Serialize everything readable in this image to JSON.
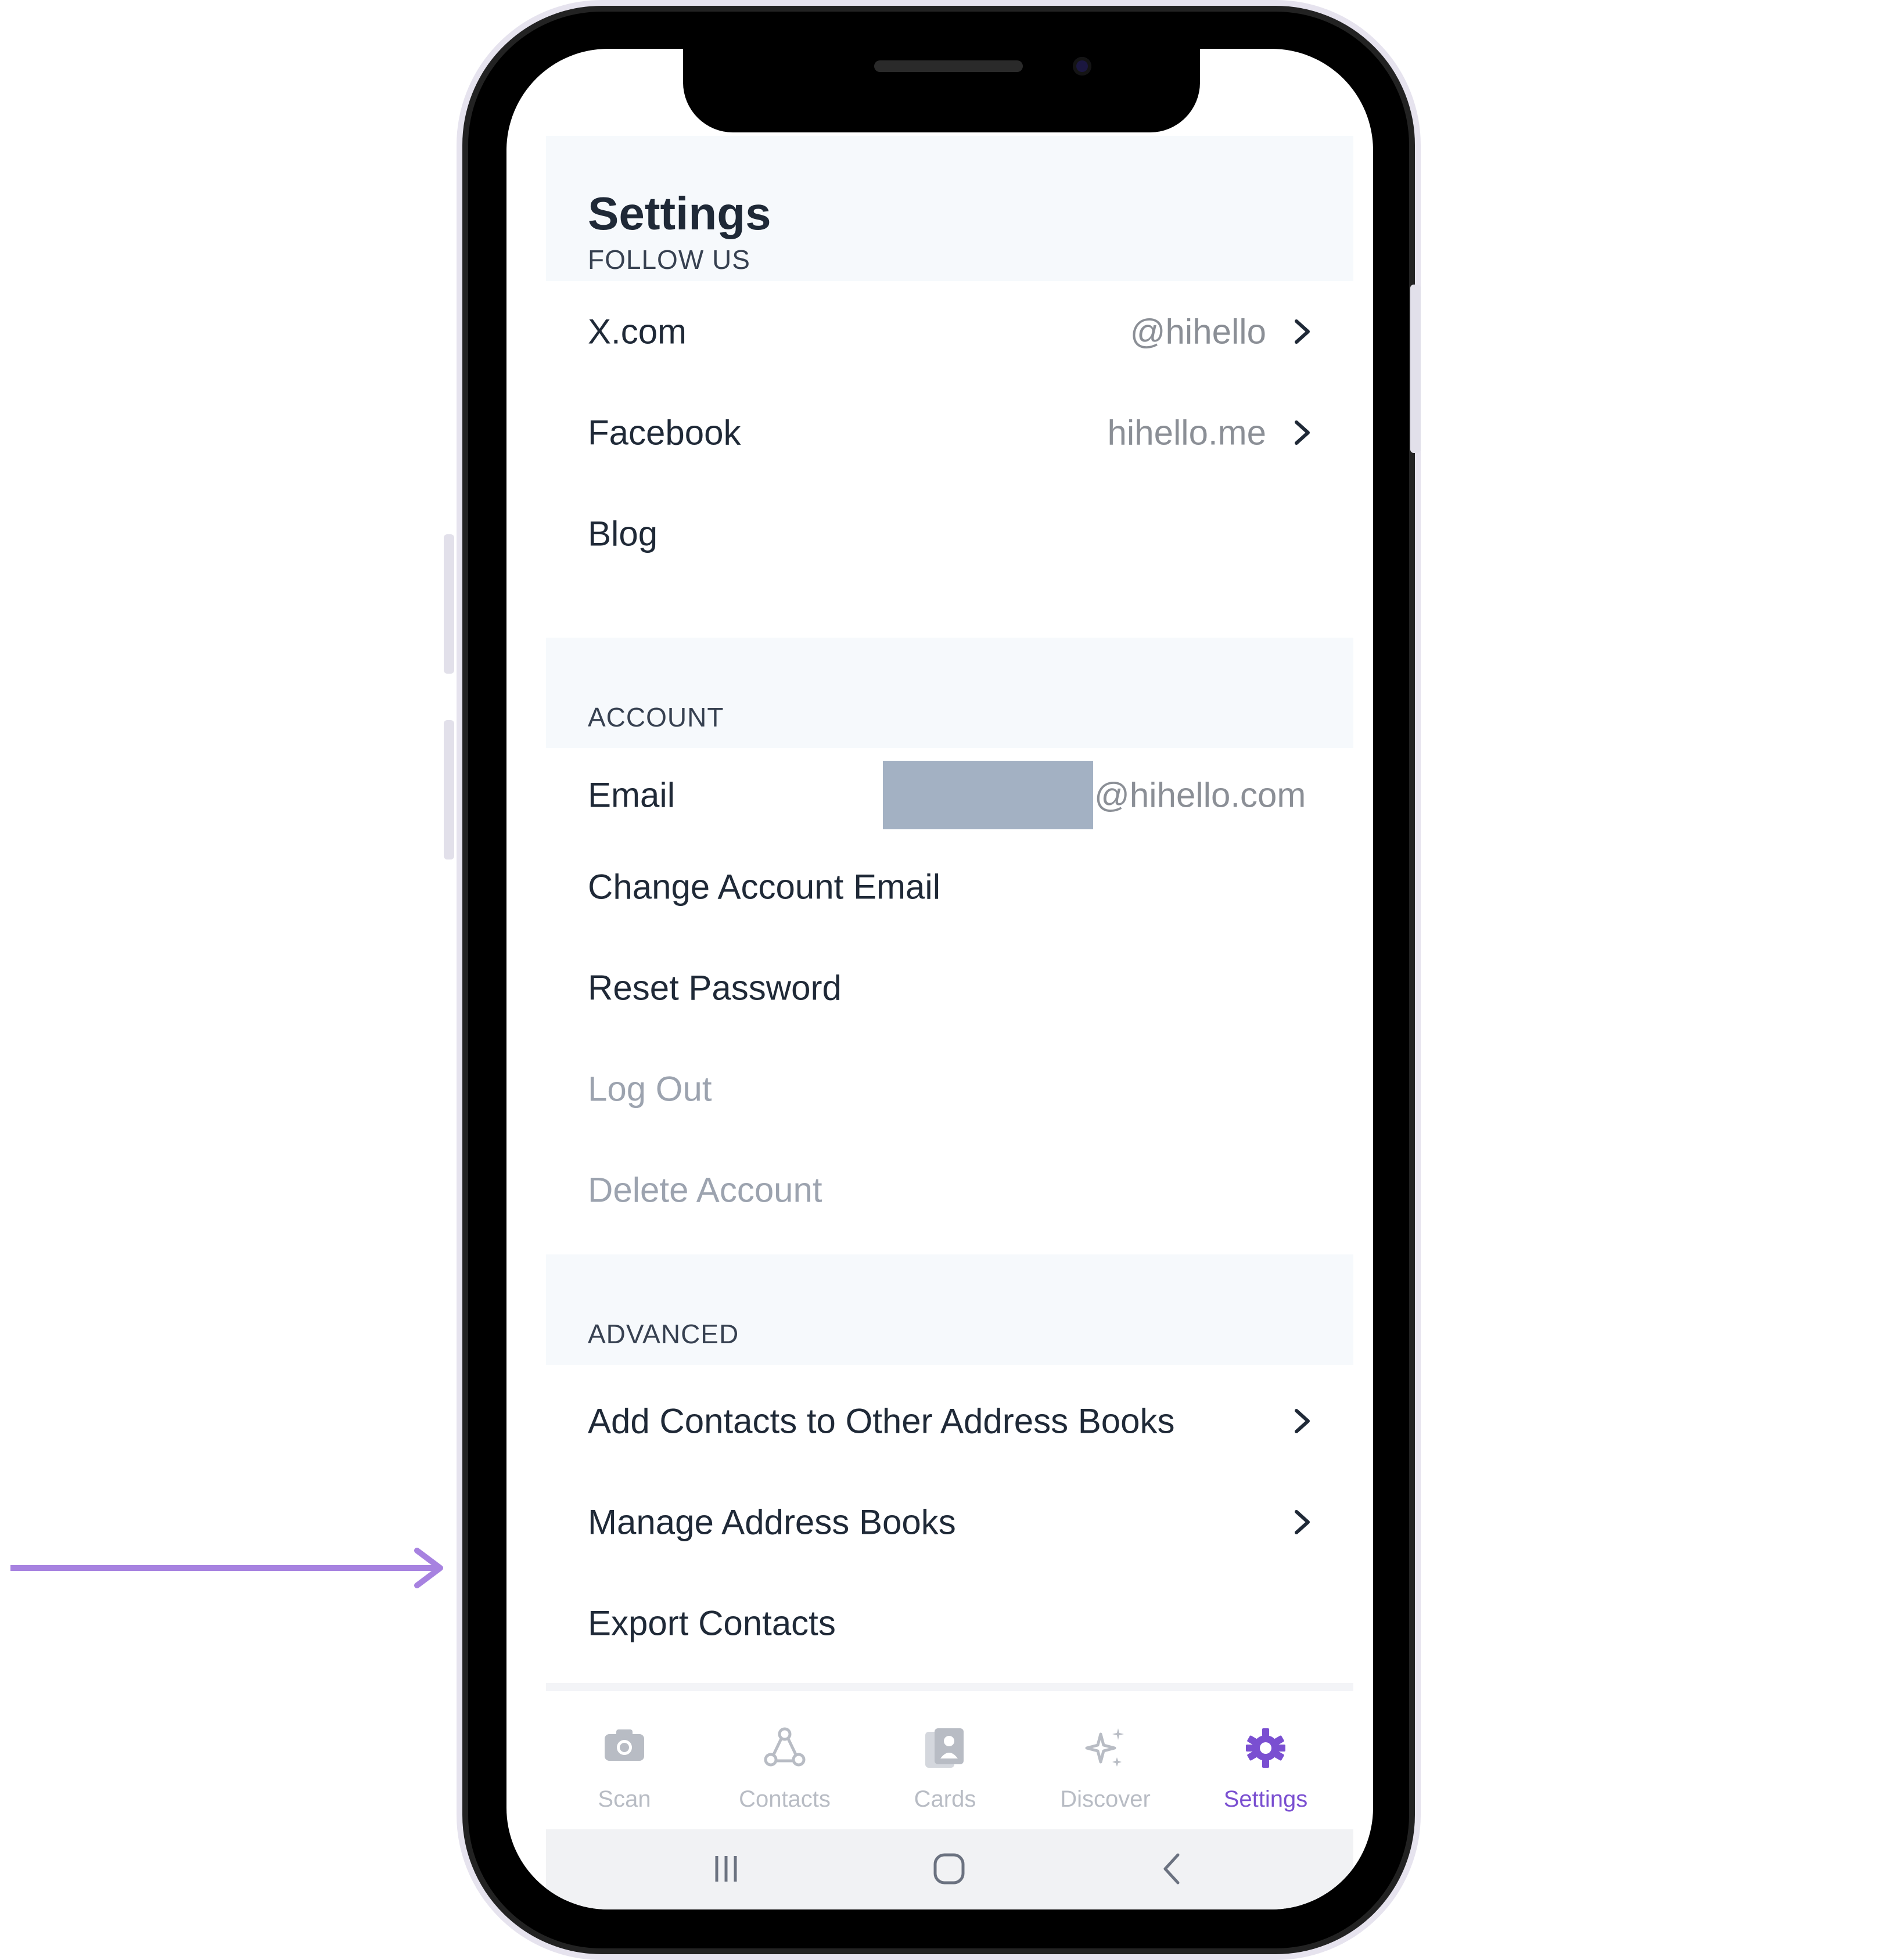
{
  "header": {
    "title": "Settings"
  },
  "sections": {
    "follow_us": {
      "label": "FOLLOW US",
      "items": [
        {
          "label": "X.com",
          "value": "@hihello"
        },
        {
          "label": "Facebook",
          "value": "hihello.me"
        },
        {
          "label": "Blog"
        }
      ]
    },
    "account": {
      "label": "ACCOUNT",
      "email": {
        "label": "Email",
        "value_suffix": "@hihello.com"
      },
      "items": [
        {
          "label": "Change Account Email"
        },
        {
          "label": "Reset Password"
        },
        {
          "label": "Log Out"
        },
        {
          "label": "Delete Account"
        }
      ]
    },
    "advanced": {
      "label": "ADVANCED",
      "items": [
        {
          "label": "Add Contacts to Other Address Books"
        },
        {
          "label": "Manage Address Books"
        },
        {
          "label": "Export Contacts"
        }
      ]
    }
  },
  "tabs": [
    {
      "label": "Scan",
      "icon": "camera-icon"
    },
    {
      "label": "Contacts",
      "icon": "contacts-icon"
    },
    {
      "label": "Cards",
      "icon": "cards-icon"
    },
    {
      "label": "Discover",
      "icon": "sparkle-icon"
    },
    {
      "label": "Settings",
      "icon": "gear-icon",
      "active": true
    }
  ],
  "colors": {
    "accent": "#7a4fd1",
    "arrow": "#a782e0",
    "section_bg": "#f6f9fc",
    "redaction": "#a3b1c3"
  }
}
